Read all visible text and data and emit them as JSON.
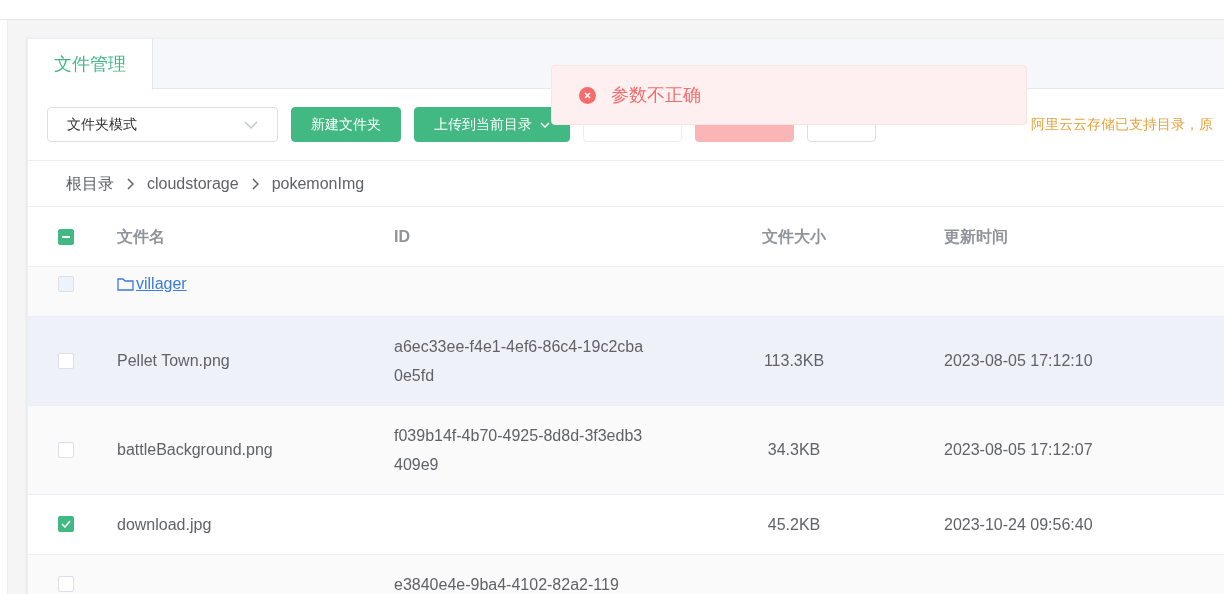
{
  "tabs": [
    {
      "label": "文件管理",
      "selected": true
    }
  ],
  "toolbar": {
    "mode_select": {
      "value": "文件夹模式"
    },
    "buttons": [
      {
        "label": "新建文件夹",
        "kind": "primary",
        "disabled": false,
        "caret": false
      },
      {
        "label": "上传到当前目录",
        "kind": "primary",
        "disabled": false,
        "caret": true
      },
      {
        "kind": "default",
        "disabled": true,
        "caret": false
      },
      {
        "kind": "danger",
        "disabled": true,
        "caret": false
      },
      {
        "kind": "default",
        "disabled": false,
        "caret": false
      }
    ],
    "notice": "阿里云云存储已支持目录，原"
  },
  "breadcrumb": [
    "根目录",
    "cloudstorage",
    "pokemonImg"
  ],
  "table": {
    "select_all": {
      "indeterminate": true
    },
    "columns": [
      "文件名",
      "ID",
      "文件大小",
      "更新时间"
    ],
    "rows": [
      {
        "kind": "folder",
        "name": "villager",
        "id": "",
        "size": "",
        "updated": "",
        "checked": false,
        "disabled": true,
        "highlighted": false
      },
      {
        "kind": "file",
        "name": "Pellet Town.png",
        "id": "a6ec33ee-f4e1-4ef6-86c4-19c2cba0e5fd",
        "size": "113.3KB",
        "updated": "2023-08-05 17:12:10",
        "checked": false,
        "disabled": false,
        "highlighted": true
      },
      {
        "kind": "file",
        "name": "battleBackground.png",
        "id": "f039b14f-4b70-4925-8d8d-3f3edb3409e9",
        "size": "34.3KB",
        "updated": "2023-08-05 17:12:07",
        "checked": false,
        "disabled": false,
        "highlighted": false
      },
      {
        "kind": "file",
        "name": "download.jpg",
        "id": "",
        "size": "45.2KB",
        "updated": "2023-10-24 09:56:40",
        "checked": true,
        "disabled": false,
        "highlighted": false
      },
      {
        "kind": "file",
        "name": "",
        "id": "e3840e4e-9ba4-4102-82a2-119",
        "size": "",
        "updated": "",
        "checked": false,
        "disabled": false,
        "highlighted": false
      }
    ]
  },
  "toast": {
    "kind": "error",
    "message": "参数不正确"
  }
}
